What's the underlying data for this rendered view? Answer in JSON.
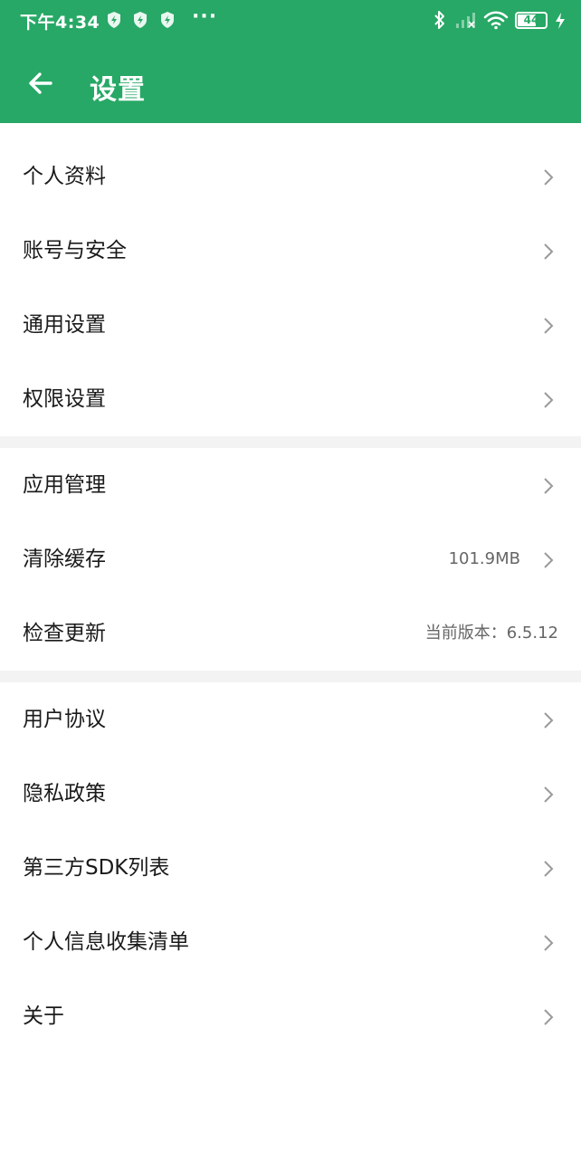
{
  "status_bar": {
    "time": "下午4:34",
    "dots": "···",
    "battery_level": "44"
  },
  "app_bar": {
    "title": "设置",
    "back_icon": "arrow-left-icon"
  },
  "groups": [
    {
      "items": [
        {
          "label": "个人资料"
        },
        {
          "label": "账号与安全"
        },
        {
          "label": "通用设置"
        },
        {
          "label": "权限设置"
        }
      ]
    },
    {
      "items": [
        {
          "label": "应用管理"
        },
        {
          "label": "清除缓存",
          "value": "101.9MB"
        },
        {
          "label": "检查更新",
          "value": "当前版本：6.5.12"
        }
      ]
    },
    {
      "items": [
        {
          "label": "用户协议"
        },
        {
          "label": "隐私政策"
        },
        {
          "label": "第三方SDK列表"
        },
        {
          "label": "个人信息收集清单"
        },
        {
          "label": "关于"
        }
      ]
    }
  ],
  "colors": {
    "brand": "#27a866",
    "separator": "#f3f3f3",
    "chevron": "#9a9a9a"
  }
}
